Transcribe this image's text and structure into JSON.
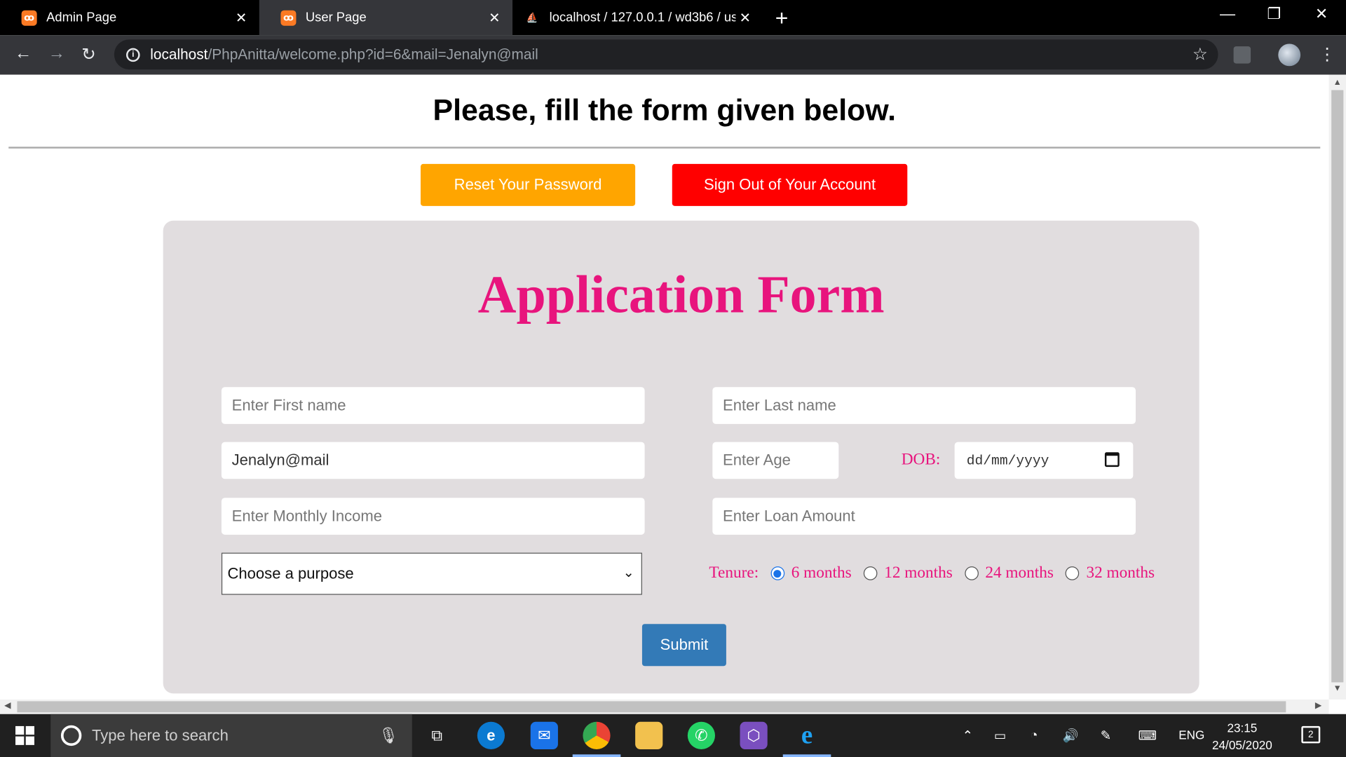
{
  "browser": {
    "tabs": [
      {
        "label": "Admin Page",
        "active": false
      },
      {
        "label": "User Page",
        "active": true
      },
      {
        "label": "localhost / 127.0.0.1 / wd3b6 / us",
        "active": false
      }
    ],
    "url_host": "localhost",
    "url_path": "/PhpAnitta/welcome.php?id=6&mail=Jenalyn@mail"
  },
  "page": {
    "heading": "Please, fill the form given below.",
    "reset_label": "Reset Your Password",
    "signout_label": "Sign Out of Your Account",
    "reset_color": "#ffa500",
    "signout_color": "#ff0000"
  },
  "form": {
    "title": "Application Form",
    "title_color": "#e8147d",
    "first_name_placeholder": "Enter First name",
    "last_name_placeholder": "Enter Last name",
    "email_value": "Jenalyn@mail",
    "age_placeholder": "Enter Age",
    "dob_label": "DOB:",
    "dob_placeholder": "dd/mm/yyyy",
    "income_placeholder": "Enter Monthly Income",
    "loan_placeholder": "Enter Loan Amount",
    "purpose_selected": "Choose a purpose",
    "tenure_label": "Tenure:",
    "tenure_options": [
      "6 months",
      "12 months",
      "24 months",
      "32 months"
    ],
    "tenure_selected": "6 months",
    "submit_label": "Submit",
    "submit_color": "#337ab7"
  },
  "taskbar": {
    "search_placeholder": "Type here to search",
    "language": "ENG",
    "time": "23:15",
    "date": "24/05/2020",
    "notification_count": "2"
  }
}
